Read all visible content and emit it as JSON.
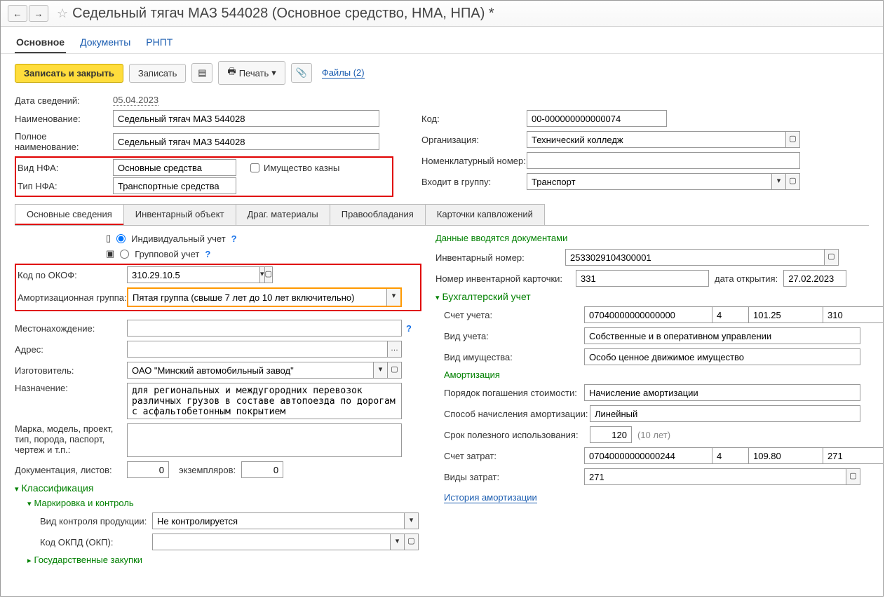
{
  "title": "Седельный тягач МАЗ 544028 (Основное средство, НМА, НПА) *",
  "page_tabs": {
    "main": "Основное",
    "docs": "Документы",
    "rnpt": "РНПТ"
  },
  "toolbar": {
    "save_close": "Записать и закрыть",
    "save": "Записать",
    "print": "Печать",
    "files": "Файлы (2)"
  },
  "labels": {
    "info_date": "Дата сведений:",
    "name": "Наименование:",
    "full_name": "Полное наименование:",
    "nfa_kind": "Вид НФА:",
    "nfa_type": "Тип НФА:",
    "code": "Код:",
    "org": "Организация:",
    "nomenclature_no": "Номенклатурный номер:",
    "group": "Входит в группу:",
    "treasury": "Имущество казны",
    "acct_individual": "Индивидуальный учет",
    "acct_group": "Групповой учет",
    "okof": "Код по ОКОФ:",
    "amort_group": "Амортизационная группа:",
    "location": "Местонахождение:",
    "address": "Адрес:",
    "manufacturer": "Изготовитель:",
    "purpose": "Назначение:",
    "model": "Марка, модель, проект, тип, порода, паспорт, чертеж и т.п.:",
    "docs_sheets": "Документация, листов:",
    "copies": "экземпляров:",
    "classification": "Классификация",
    "marking": "Маркировка и контроль",
    "control_kind": "Вид контроля продукции:",
    "okpd": "Код ОКПД (ОКП):",
    "gov_purchases": "Государственные закупки",
    "docs_auto": "Данные вводятся документами",
    "inv_no": "Инвентарный номер:",
    "inv_card_no": "Номер инвентарной карточки:",
    "open_date": "дата открытия:",
    "accounting": "Бухгалтерский учет",
    "account": "Счет учета:",
    "acct_kind": "Вид учета:",
    "property_kind": "Вид имущества:",
    "amortization": "Амортизация",
    "repayment": "Порядок погашения стоимости:",
    "method": "Способ начисления амортизации:",
    "useful_life": "Срок полезного использования:",
    "useful_note": "(10 лет)",
    "expense_acct": "Счет затрат:",
    "expense_kinds": "Виды затрат:",
    "history": "История амортизации"
  },
  "inner_tabs": {
    "main": "Основные сведения",
    "inv": "Инвентарный объект",
    "metals": "Драг. материалы",
    "rights": "Правообладания",
    "cards": "Карточки капвложений"
  },
  "values": {
    "info_date": "05.04.2023",
    "name": "Седельный тягач МАЗ 544028",
    "full_name": "Седельный тягач МАЗ 544028",
    "nfa_kind": "Основные средства",
    "nfa_type": "Транспортные средства",
    "code": "00-000000000000074",
    "org": "Технический колледж",
    "nomenclature_no": "",
    "group": "Транспорт",
    "okof": "310.29.10.5",
    "amort_group": "Пятая группа (свыше 7 лет до 10 лет включительно)",
    "location": "",
    "address": "",
    "manufacturer": "ОАО \"Минский автомобильный завод\"",
    "purpose": "для региональных и междугородних перевозок различных грузов в составе автопоезда по дорогам с асфальтобетонным покрытием",
    "model": "",
    "docs_sheets": "0",
    "copies": "0",
    "control_kind": "Не контролируется",
    "okpd": "",
    "inv_no": "2533029104300001",
    "inv_card_no": "331",
    "open_date": "27.02.2023",
    "account1": "07040000000000000",
    "account2": "4",
    "account3": "101.25",
    "account4": "310",
    "acct_kind": "Собственные и в оперативном управлении",
    "property_kind": "Особо ценное движимое имущество",
    "repayment": "Начисление амортизации",
    "method": "Линейный",
    "useful_life": "120",
    "expense1": "07040000000000244",
    "expense2": "4",
    "expense3": "109.80",
    "expense4": "271",
    "expense_kinds": "271"
  }
}
